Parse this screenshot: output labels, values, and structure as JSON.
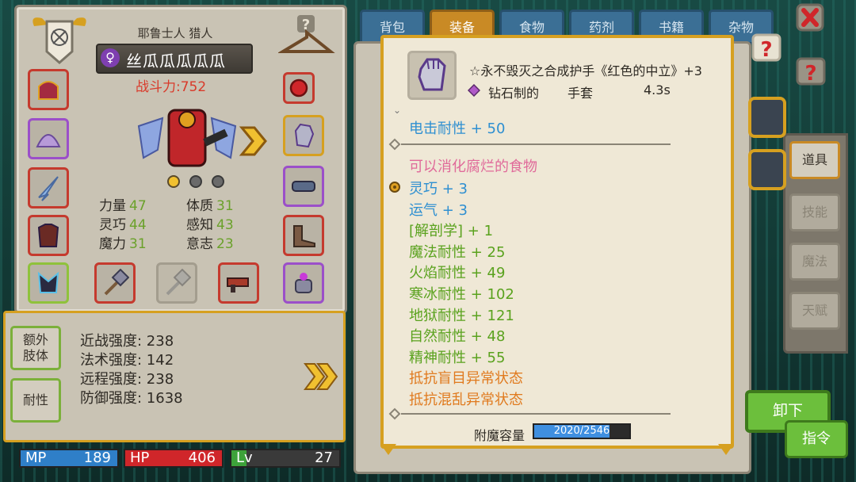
{
  "character": {
    "race_class": "耶鲁士人 猎人",
    "name": "丝瓜瓜瓜瓜瓜",
    "gender_symbol": "♀",
    "combat_power": "战斗力:752",
    "attributes": [
      {
        "label": "力量",
        "value": "47"
      },
      {
        "label": "体质",
        "value": "31"
      },
      {
        "label": "灵巧",
        "value": "44"
      },
      {
        "label": "感知",
        "value": "43"
      },
      {
        "label": "魔力",
        "value": "31"
      },
      {
        "label": "意志",
        "value": "23"
      }
    ],
    "page_dots": {
      "count": 3,
      "active": 0
    }
  },
  "stat_box": {
    "buttons": [
      "额外\n肢体",
      "耐性"
    ],
    "lines": [
      "近战强度: 238",
      "法术强度: 142",
      "远程强度: 238",
      "防御强度: 1638"
    ]
  },
  "resources": {
    "mp": {
      "label": "MP",
      "value": "189",
      "color": "#2f7fc8"
    },
    "hp": {
      "label": "HP",
      "value": "406",
      "color": "#d0262a"
    },
    "lv": {
      "label": "Lv",
      "value": "27",
      "color": "#3da23a",
      "progress": 0.14
    }
  },
  "tabs": [
    {
      "label": "背包",
      "active": false
    },
    {
      "label": "装备",
      "active": true
    },
    {
      "label": "食物",
      "active": false
    },
    {
      "label": "药剂",
      "active": false
    },
    {
      "label": "书籍",
      "active": false
    },
    {
      "label": "杂物",
      "active": false
    }
  ],
  "side_tabs": [
    {
      "label": "道具",
      "active": true
    },
    {
      "label": "技能",
      "active": false
    },
    {
      "label": "魔法",
      "active": false
    },
    {
      "label": "天赋",
      "active": false
    }
  ],
  "buttons": {
    "unequip": "卸下",
    "command": "指令"
  },
  "tooltip": {
    "item_title": "☆永不毁灭之合成护手《红色的中立》+3",
    "material": "钻石制的",
    "slot_type": "手套",
    "weight": "4.3s",
    "primary_line": "电击耐性 + 50",
    "special_line": "可以消化腐烂的食物",
    "bonus_lines": [
      {
        "text": "灵巧 + 3",
        "color": "blue"
      },
      {
        "text": "运气 + 3",
        "color": "blue"
      },
      {
        "text": "[解剖学] + 1",
        "color": "green"
      },
      {
        "text": "魔法耐性 + 25",
        "color": "green"
      },
      {
        "text": "火焰耐性 + 49",
        "color": "green"
      },
      {
        "text": "寒冰耐性 + 102",
        "color": "green"
      },
      {
        "text": "地狱耐性 + 121",
        "color": "green"
      },
      {
        "text": "自然耐性 + 48",
        "color": "green"
      },
      {
        "text": "精神耐性 + 55",
        "color": "green"
      },
      {
        "text": "抵抗盲目异常状态",
        "color": "orange"
      },
      {
        "text": "抵抗混乱异常状态",
        "color": "orange"
      }
    ],
    "enchant_label": "附魔容量",
    "enchant_value": "2020/2546",
    "enchant_ratio": 0.79
  },
  "icons": [
    "crest-icon",
    "hanger-icon",
    "close-icon",
    "help-icon",
    "gauntlet-icon",
    "diamond-icon",
    "arrow-right-icon",
    "bow-icon"
  ]
}
